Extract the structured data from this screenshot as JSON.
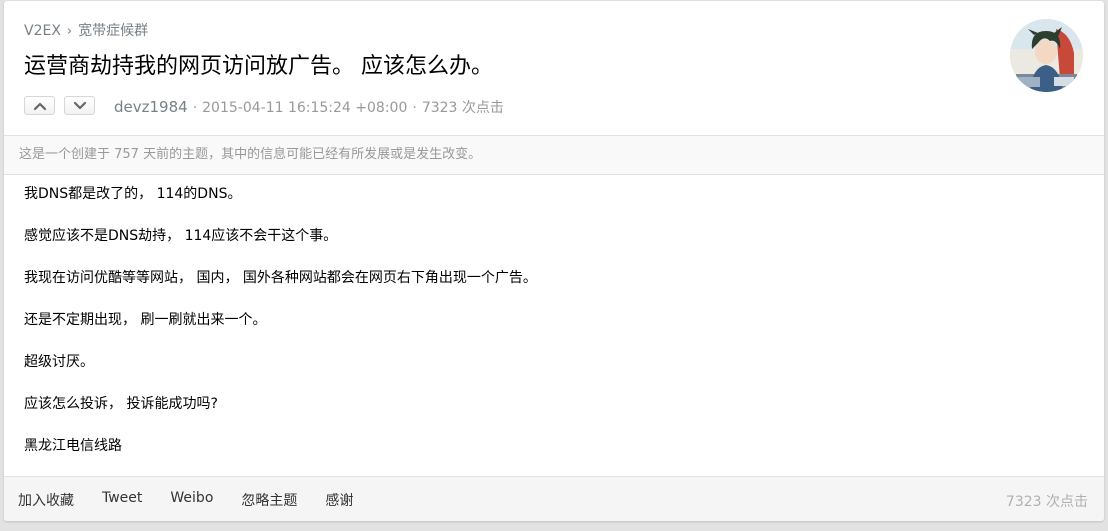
{
  "breadcrumb": {
    "site": "V2EX",
    "separator": "›",
    "node": "宽带症候群"
  },
  "topic": {
    "title": "运营商劫持我的网页访问放广告。 应该怎么办。",
    "author": "devz1984",
    "datetime": "2015-04-11 16:15:24 +08:00",
    "views": "7323 次点击",
    "dot": "·"
  },
  "icons": {
    "upvote": "chevron-up-icon",
    "downvote": "chevron-down-icon",
    "avatar": "user-avatar"
  },
  "notice": "这是一个创建于 757 天前的主题，其中的信息可能已经有所发展或是发生改变。",
  "content": {
    "paragraphs": [
      "我DNS都是改了的， 114的DNS。",
      "感觉应该不是DNS劫持， 114应该不会干这个事。",
      "我现在访问优酷等等网站， 国内， 国外各种网站都会在网页右下角出现一个广告。",
      "还是不定期出现， 刷一刷就出来一个。",
      "超级讨厌。",
      "应该怎么投诉， 投诉能成功吗?",
      "黑龙江电信线路"
    ]
  },
  "footer": {
    "favorite": "加入收藏",
    "tweet": "Tweet",
    "weibo": "Weibo",
    "ignore": "忽略主题",
    "thank": "感谢",
    "views": "7323 次点击"
  },
  "colors": {
    "link_gray": "#778087",
    "meta_gray": "#999999",
    "footer_bg": "#f5f5f5",
    "notice_bg": "#f9f9f9"
  }
}
